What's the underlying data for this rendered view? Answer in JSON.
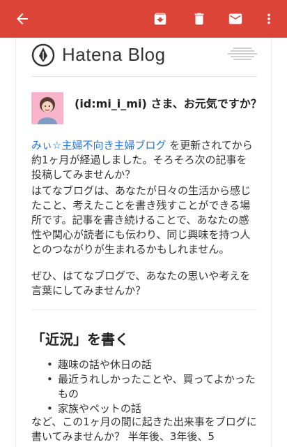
{
  "toolbar": {
    "back": "back-arrow-icon",
    "archive": "archive-icon",
    "delete": "trash-icon",
    "mail": "mail-icon",
    "more": "more-vert-icon"
  },
  "brand": {
    "name": "Hatena Blog"
  },
  "greeting": {
    "text": "(id:mi_i_mi) さま、お元気ですか？"
  },
  "paragraphs": {
    "p1_link": "みぃ☆主婦不向き主婦ブログ",
    "p1_rest": " を更新されてから約1ヶ月が経過しました。そろそろ次の記事を投稿してみませんか？",
    "p2": "はてなブログは、あなたが日々の生活から感じたこと、考えたことを書き残すことができる場所です。記事を書き続けることで、あなたの感性や関心が読者にも伝わり、同じ興味を持つ人とのつながりが生まれるかもしれません。",
    "p3": "ぜひ、はてなブログで、あなたの思いや考えを言葉にしてみませんか？"
  },
  "section": {
    "heading": "「近況」を書く",
    "items": [
      "趣味の話や休日の話",
      "最近うれしかったことや、買ってよかったもの",
      "家族やペットの話"
    ],
    "footer": "など、この1ヶ月の間に起きた出来事をブログに書いてみませんか？ 半年後、3年後、5"
  },
  "colors": {
    "appbar": "#db4437",
    "link": "#1a73e8"
  }
}
